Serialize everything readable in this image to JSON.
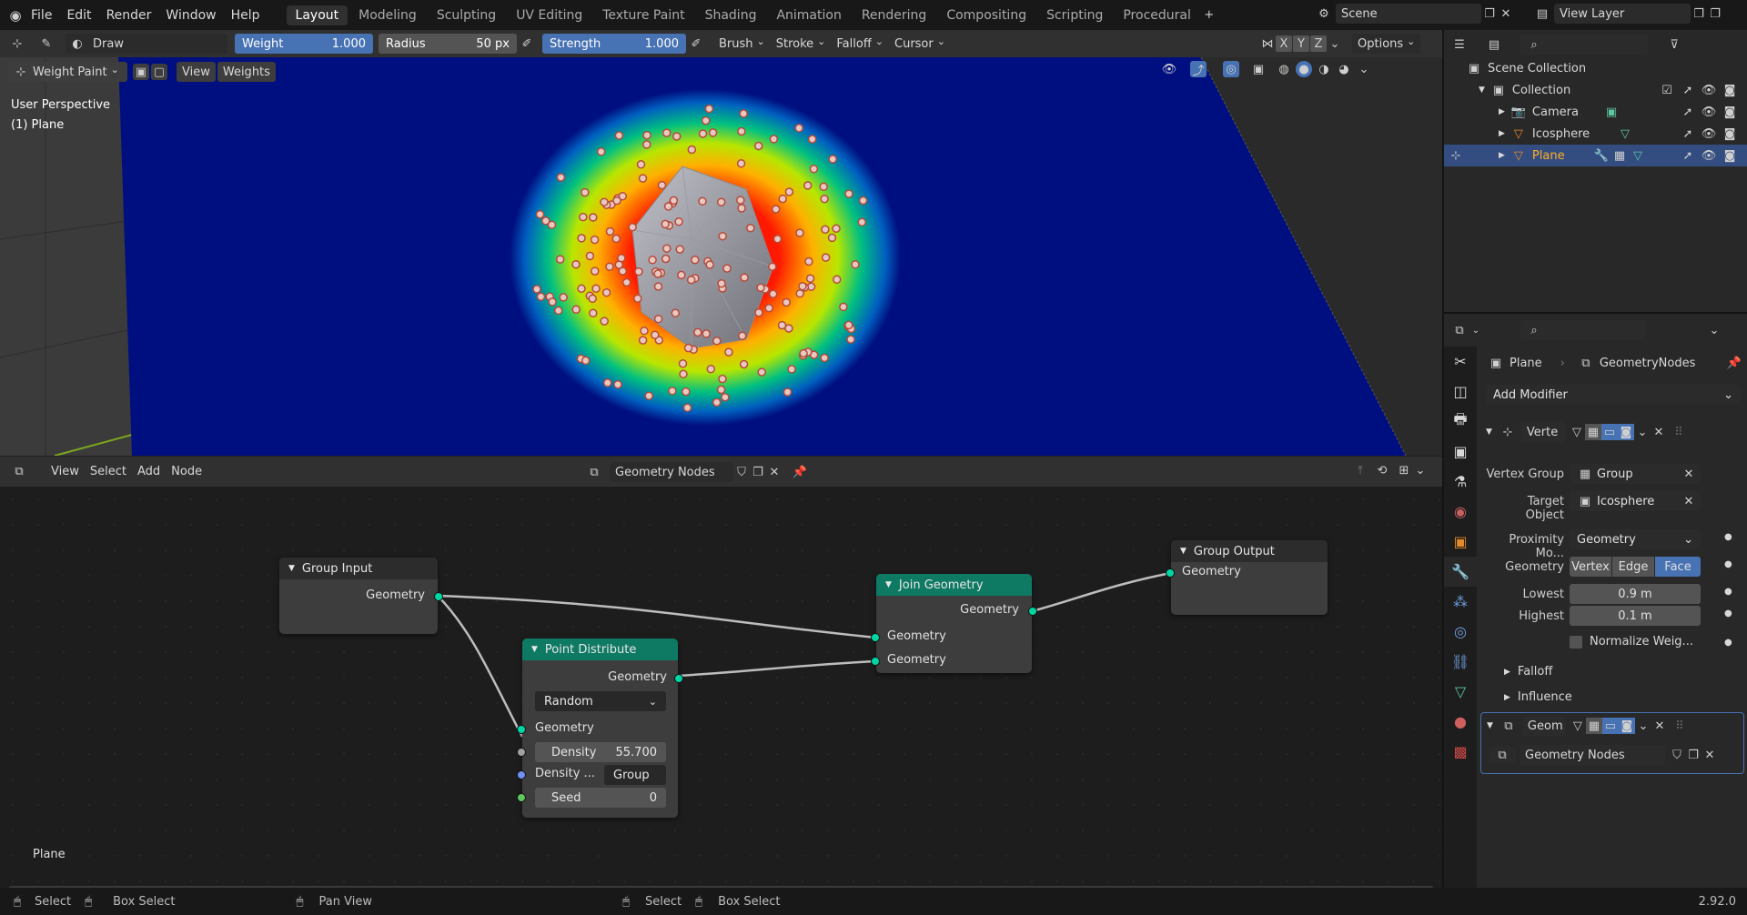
{
  "topbar": {
    "menus": [
      "File",
      "Edit",
      "Render",
      "Window",
      "Help"
    ],
    "workspaces": [
      "Layout",
      "Modeling",
      "Sculpting",
      "UV Editing",
      "Texture Paint",
      "Shading",
      "Animation",
      "Rendering",
      "Compositing",
      "Scripting",
      "Procedural"
    ],
    "active_workspace": "Layout",
    "scene": "Scene",
    "view_layer": "View Layer"
  },
  "tool_header": {
    "brush_name": "Draw",
    "weight_label": "Weight",
    "weight_value": "1.000",
    "radius_label": "Radius",
    "radius_value": "50 px",
    "strength_label": "Strength",
    "strength_value": "1.000",
    "menus": [
      "Brush",
      "Stroke",
      "Falloff",
      "Cursor"
    ],
    "axes": [
      "X",
      "Y",
      "Z"
    ],
    "options": "Options"
  },
  "viewport": {
    "mode": "Weight Paint",
    "menus": [
      "View",
      "Weights"
    ],
    "perspective": "User Perspective",
    "object": "(1) Plane"
  },
  "node_editor": {
    "menus": [
      "View",
      "Select",
      "Add",
      "Node"
    ],
    "tree_name": "Geometry Nodes",
    "footer_label": "Plane",
    "nodes": {
      "group_input": {
        "title": "Group Input",
        "out_geometry": "Geometry"
      },
      "point_distribute": {
        "title": "Point Distribute",
        "out_geometry": "Geometry",
        "mode": "Random",
        "in_geometry": "Geometry",
        "density_label": "Density",
        "density_value": "55.700",
        "density_attr_label": "Density ...",
        "density_attr_value": "Group",
        "seed_label": "Seed",
        "seed_value": "0"
      },
      "join_geometry": {
        "title": "Join Geometry",
        "out_geometry": "Geometry",
        "in_geometry_1": "Geometry",
        "in_geometry_2": "Geometry"
      },
      "group_output": {
        "title": "Group Output",
        "in_geometry": "Geometry"
      }
    }
  },
  "status": {
    "items": [
      "Select",
      "Box Select",
      "Pan View",
      "Select",
      "Box Select"
    ],
    "version": "2.92.0"
  },
  "outliner": {
    "root": "Scene Collection",
    "collection": "Collection",
    "items": [
      "Camera",
      "Icosphere",
      "Plane"
    ],
    "selected": "Plane"
  },
  "properties": {
    "object": "Plane",
    "modifier_tree": "GeometryNodes",
    "add_modifier": "Add Modifier",
    "mod1_name": "Verte",
    "vertex_group_label": "Vertex Group",
    "vertex_group_value": "Group",
    "target_object_label": "Target Object",
    "target_object_value": "Icosphere",
    "proximity_mode_label": "Proximity Mo...",
    "proximity_mode_value": "Geometry",
    "geometry_label": "Geometry",
    "geometry_opts": [
      "Vertex",
      "Edge",
      "Face"
    ],
    "geometry_active": "Face",
    "lowest_label": "Lowest",
    "lowest_value": "0.9 m",
    "highest_label": "Highest",
    "highest_value": "0.1 m",
    "normalize_label": "Normalize Weig...",
    "falloff_panel": "Falloff",
    "influence_panel": "Influence",
    "mod2_name": "Geom",
    "mod2_tree": "Geometry Nodes"
  },
  "colors": {
    "accent_blue": "#4772b3",
    "node_geo_header": "#0f7a63",
    "socket_geometry": "#00d6a3",
    "selected_orange": "#ffaf29"
  }
}
